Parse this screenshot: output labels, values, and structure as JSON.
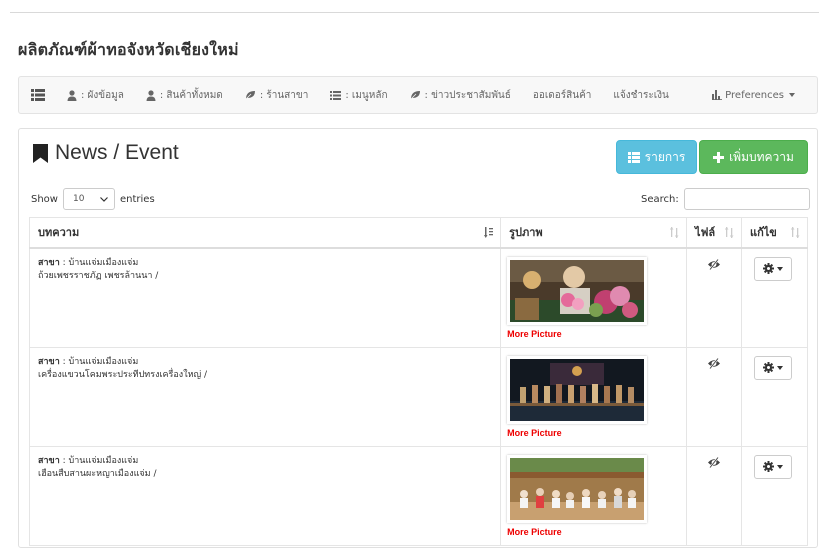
{
  "site_title": "ผลิตภัณฑ์ผ้าทอจังหวัดเชียงใหม่",
  "nav": {
    "items": [
      {
        "label": ": ผังข้อมูล",
        "icon": "user-tie-icon"
      },
      {
        "label": ": สินค้าทั้งหมด",
        "icon": "user-tie-icon"
      },
      {
        "label": ": ร้านสาขา",
        "icon": "leaf-icon"
      },
      {
        "label": ": เมนูหลัก",
        "icon": "list-icon"
      },
      {
        "label": ": ข่าวประชาสัมพันธ์",
        "icon": "leaf-icon"
      },
      {
        "label": "ออเดอร์สินค้า",
        "icon": ""
      },
      {
        "label": "แจ้งชำระเงิน",
        "icon": ""
      }
    ],
    "preferences_label": "Preferences"
  },
  "panel": {
    "title": "News / Event",
    "list_button": "รายการ",
    "add_button": "เพิ่มบทความ",
    "show_label": "Show",
    "page_size": "10",
    "entries_label": "entries",
    "search_label": "Search:",
    "search_value": ""
  },
  "table": {
    "headers": [
      "บทความ",
      "รูปภาพ",
      "ไฟล์",
      "แก้ไข"
    ],
    "rows": [
      {
        "branch_label": "สาขา",
        "branch": " : บ้านแจ่มเมืองแจ่ม",
        "title": "ถ้วยเพชรราชภัฏ เพชรล้านนา /",
        "more": "More Picture"
      },
      {
        "branch_label": "สาขา",
        "branch": " : บ้านแจ่มเมืองแจ่ม",
        "title": "เครื่องแขวนโคมพระประทีปทรงเครื่องใหญ่ /",
        "more": "More Picture"
      },
      {
        "branch_label": "สาขา",
        "branch": " : บ้านแจ่มเมืองแจ่ม",
        "title": "เฮือนสืบสานผะหญาเมืองแจ่ม /",
        "more": "More Picture"
      }
    ]
  },
  "colors": {
    "info": "#5bc0de",
    "success": "#5cb85c",
    "more_link": "#ee0000"
  }
}
